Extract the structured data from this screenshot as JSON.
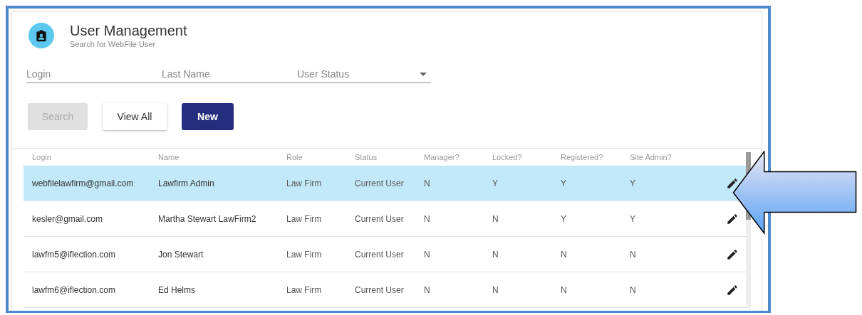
{
  "header": {
    "title": "User Management",
    "subtitle": "Search for WebFile User"
  },
  "filters": [
    {
      "kind": "text",
      "placeholder": "Login"
    },
    {
      "kind": "text",
      "placeholder": "Last Name"
    },
    {
      "kind": "select",
      "placeholder": "User Status"
    }
  ],
  "buttons": [
    {
      "label": "Search",
      "kind": "plain",
      "disabled": true
    },
    {
      "label": "View All",
      "kind": "plain",
      "disabled": false
    },
    {
      "label": "New",
      "kind": "primary",
      "disabled": false
    }
  ],
  "table": {
    "columns": [
      "Login",
      "Name",
      "Role",
      "Status",
      "Manager?",
      "Locked?",
      "Registered?",
      "Site Admin?"
    ],
    "rows": [
      {
        "selected": true,
        "cells": [
          "webfilelawfirm@gmail.com",
          "Lawfirm Admin",
          "Law Firm",
          "Current User",
          "N",
          "Y",
          "Y",
          "Y"
        ]
      },
      {
        "selected": false,
        "cells": [
          "kesler@gmail.com",
          "Martha Stewart LawFirm2",
          "Law Firm",
          "Current User",
          "N",
          "N",
          "Y",
          "Y"
        ]
      },
      {
        "selected": false,
        "cells": [
          "lawfm5@iflection.com",
          "Jon Stewart",
          "Law Firm",
          "Current User",
          "N",
          "N",
          "N",
          "N"
        ]
      },
      {
        "selected": false,
        "cells": [
          "lawfm6@iflection.com",
          "Ed Helms",
          "Law Firm",
          "Current User",
          "N",
          "N",
          "N",
          "N"
        ]
      }
    ]
  }
}
